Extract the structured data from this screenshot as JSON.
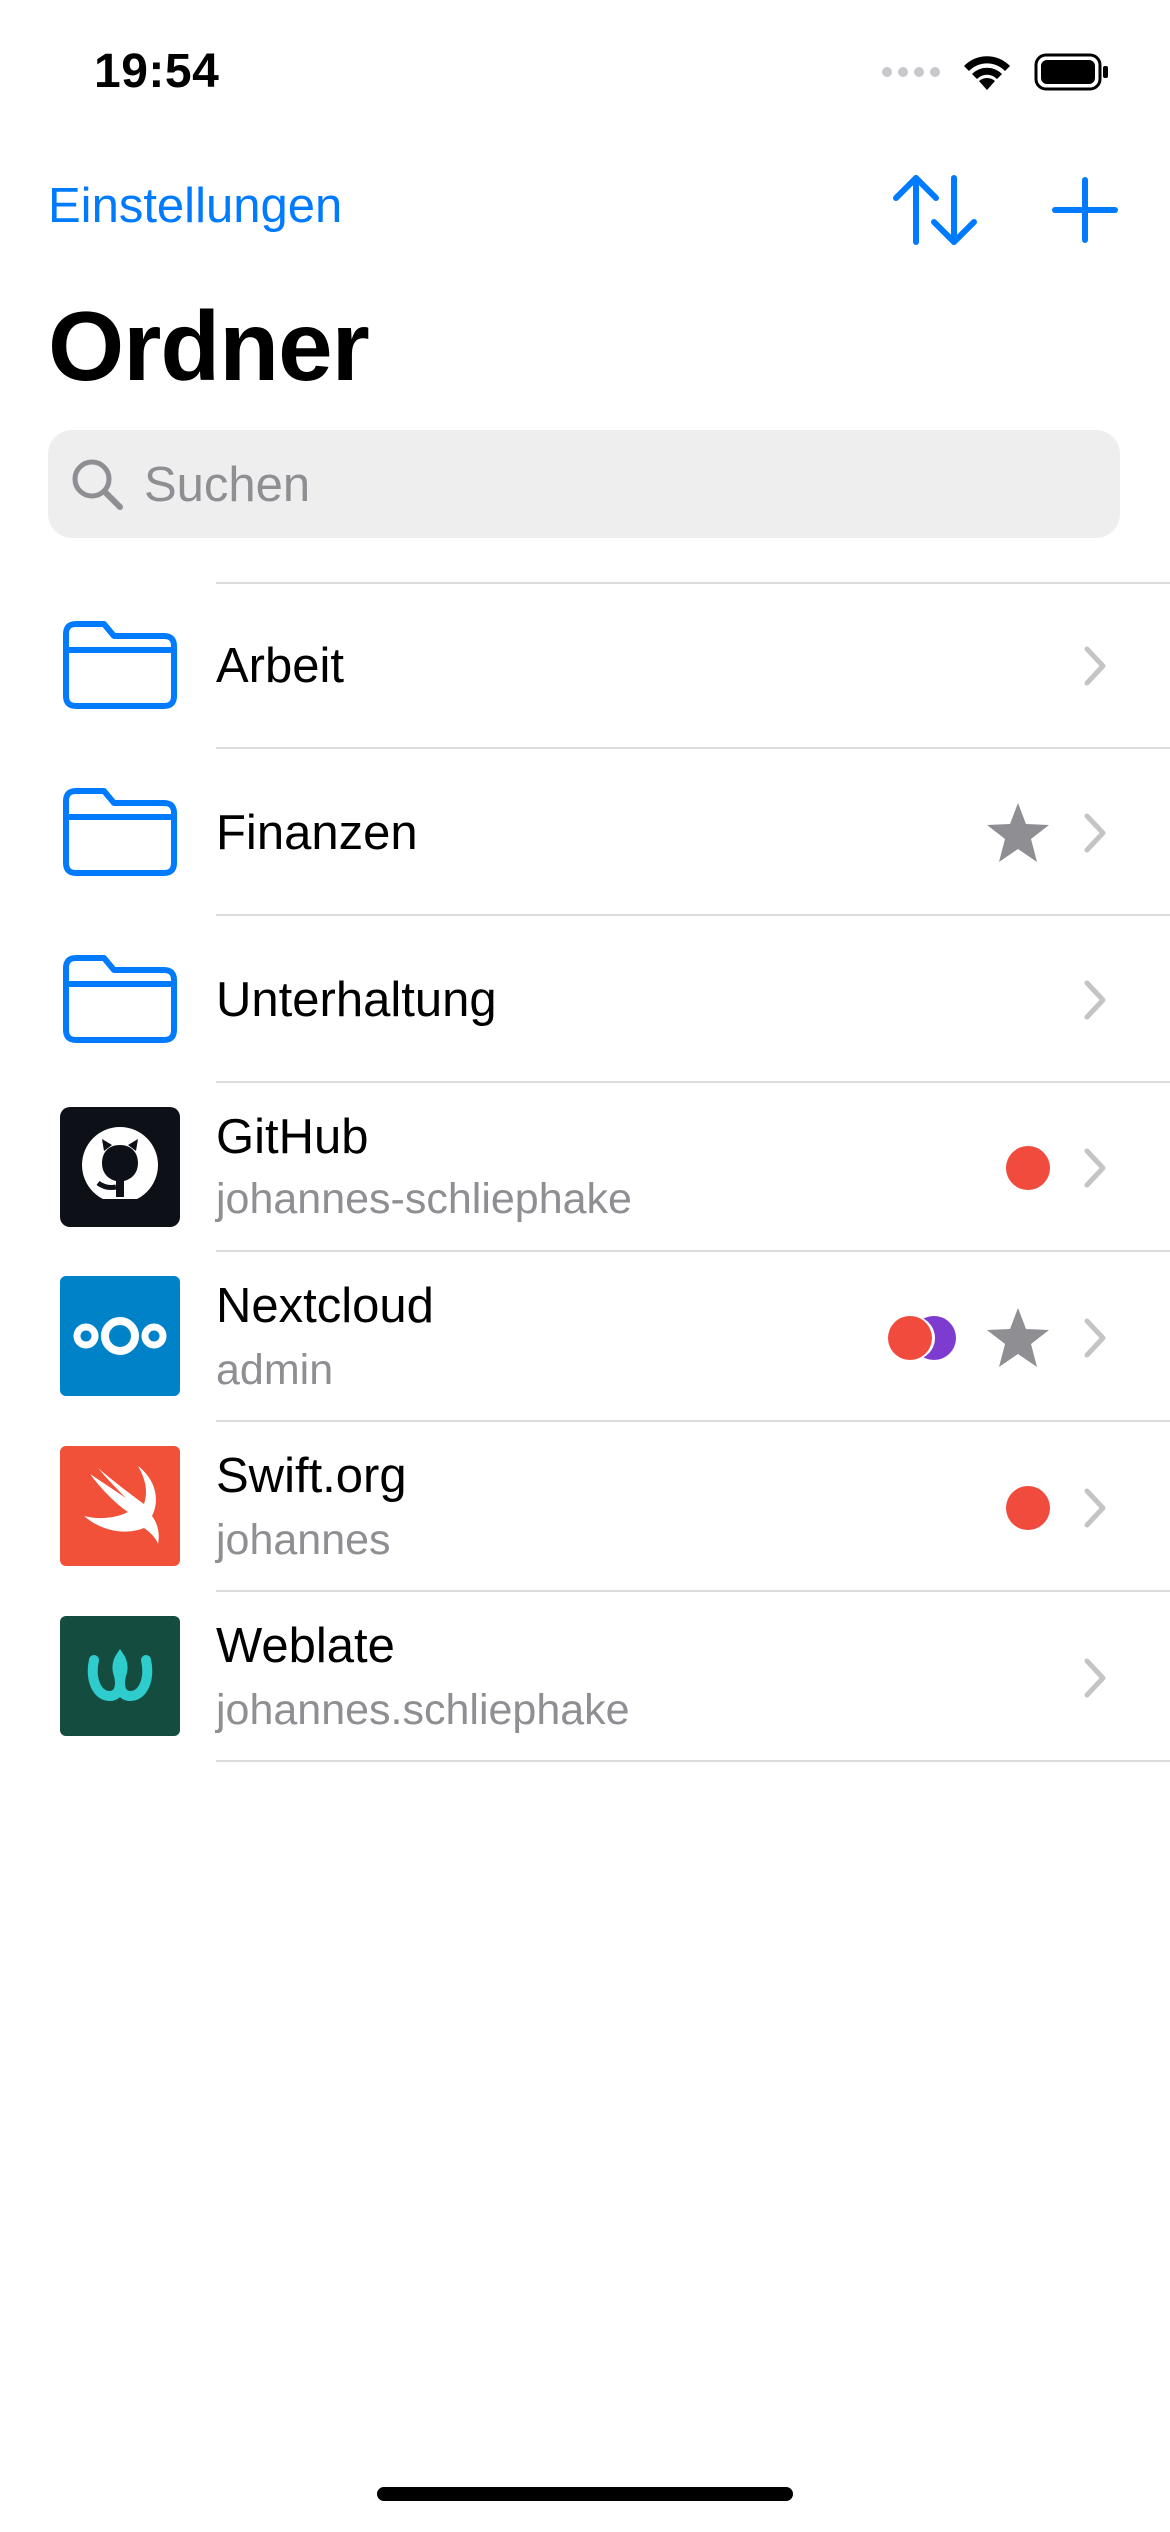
{
  "status": {
    "time": "19:54"
  },
  "nav": {
    "left_label": "Einstellungen",
    "sort_icon": "sort-arrows-icon",
    "add_icon": "plus-icon"
  },
  "title": "Ordner",
  "search": {
    "placeholder": "Suchen",
    "value": ""
  },
  "colors": {
    "accent": "#007aff",
    "secondary_text": "#8e8e93",
    "separator": "#dcdcde",
    "tag_red": "#f04b3c",
    "tag_purple": "#7d3bd0",
    "star_gray": "#8e8e93"
  },
  "items": [
    {
      "icon": "folder-icon",
      "title": "Arbeit",
      "subtitle": "",
      "starred": false,
      "tags": []
    },
    {
      "icon": "folder-icon",
      "title": "Finanzen",
      "subtitle": "",
      "starred": true,
      "tags": []
    },
    {
      "icon": "folder-icon",
      "title": "Unterhaltung",
      "subtitle": "",
      "starred": false,
      "tags": []
    },
    {
      "icon": "github-logo-icon",
      "title": "GitHub",
      "subtitle": "johannes-schliephake",
      "starred": false,
      "tags": [
        "red"
      ]
    },
    {
      "icon": "nextcloud-logo-icon",
      "title": "Nextcloud",
      "subtitle": "admin",
      "starred": true,
      "tags": [
        "red",
        "purple"
      ]
    },
    {
      "icon": "swift-logo-icon",
      "title": "Swift.org",
      "subtitle": "johannes",
      "starred": false,
      "tags": [
        "red"
      ]
    },
    {
      "icon": "weblate-logo-icon",
      "title": "Weblate",
      "subtitle": "johannes.schliephake",
      "starred": false,
      "tags": []
    }
  ]
}
